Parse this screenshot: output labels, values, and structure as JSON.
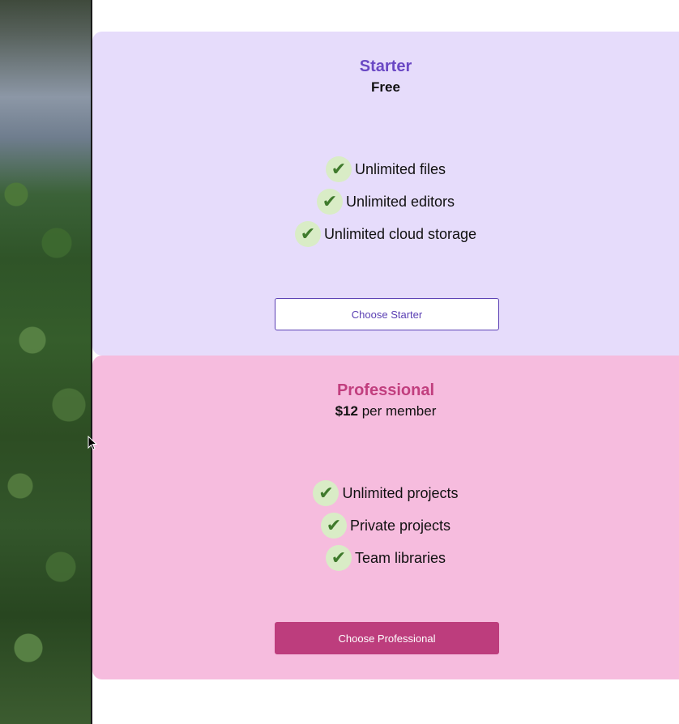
{
  "plans": [
    {
      "name": "Starter",
      "price_amount": "Free",
      "price_suffix": "",
      "features": [
        "Unlimited files",
        "Unlimited editors",
        "Unlimited cloud storage"
      ],
      "cta_label": "Choose Starter",
      "bg_color": "#e6dcfb",
      "accent_color": "#6a48c4"
    },
    {
      "name": "Professional",
      "price_amount": "$12",
      "price_suffix": " per member",
      "features": [
        "Unlimited projects",
        "Private projects",
        "Team libraries"
      ],
      "cta_label": "Choose Professional",
      "bg_color": "#f6bcde",
      "accent_color": "#bd3d7d"
    }
  ],
  "check_icon": "✔",
  "icons": {
    "feature": "check-icon",
    "pointer": "mouse-cursor-icon"
  }
}
